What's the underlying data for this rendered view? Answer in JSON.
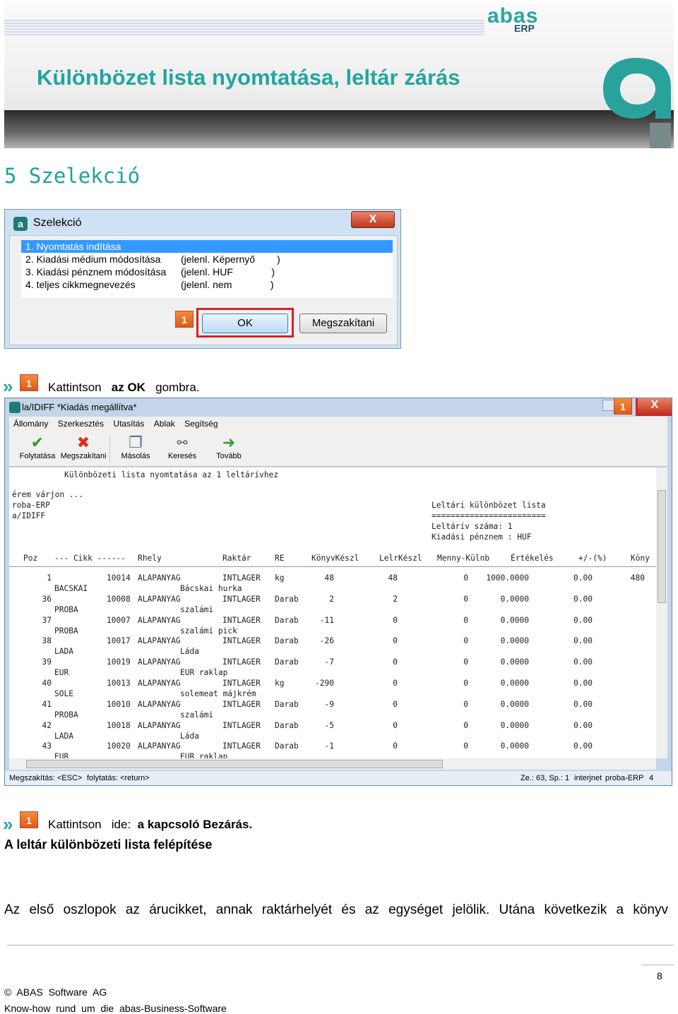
{
  "banner": {
    "title": "Különbözet lista nyomtatása, leltár zárás",
    "logo_text": "abas",
    "logo_sub": "ERP"
  },
  "section_title": "5 Szelekció",
  "dialog": {
    "title": "Szelekció",
    "close": "X",
    "items": [
      {
        "label": "1. Nyomtatás indítása",
        "value": ""
      },
      {
        "label": "2. Kiadási médium módosítása",
        "value": "(jelenl. Képernyő        )"
      },
      {
        "label": "3. Kiadási pénznem módosítása",
        "value": "(jelenl. HUF              )"
      },
      {
        "label": "4. teljes cikkmegnevezés",
        "value": "(jelenl. nem              )"
      }
    ],
    "badge": "1",
    "ok": "OK",
    "cancel": "Megszakítani"
  },
  "instruction1": {
    "marker": "»",
    "badge": "1",
    "pre": "Kattintson",
    "bold": "az OK",
    "post": "gombra."
  },
  "app": {
    "title": "la/IDIFF  *Kiadás megállítva*",
    "close": "X",
    "badge": "1",
    "menu": [
      "Állomány",
      "Szerkesztés",
      "Utasítás",
      "Ablak",
      "Segítség"
    ],
    "toolbar": [
      {
        "label": "Folytatása",
        "icon": "check-icon"
      },
      {
        "label": "Megszakítani",
        "icon": "cross-icon"
      },
      {
        "label": "Másolás",
        "icon": "copy-icon"
      },
      {
        "label": "Keresés",
        "icon": "binoculars-icon"
      },
      {
        "label": "Tovább",
        "icon": "forward-icon"
      }
    ],
    "content_header": "Különbözeti lista nyomtatása az 1 leltárívhez",
    "left_lines": [
      "érem várjon ...",
      "roba-ERP",
      "a/IDIFF"
    ],
    "right_lines": [
      "Leltári különbözet lista",
      "========================",
      "Leltárív száma: 1",
      "Kiadási pénznem : HUF"
    ],
    "columns": [
      "Poz",
      "--- Cikk ------",
      "Rhely",
      "Raktár",
      "RE",
      "KönyvKészl",
      "LelrKészl",
      "Menny-Külnb",
      "Értékelés",
      "+/-(%)",
      "Köny"
    ],
    "rows": [
      {
        "poz": "1",
        "cikk": "10014",
        "type": "ALAPANYAG",
        "store": "INTLAGER",
        "unit": "kg",
        "book": "48",
        "inv": "48",
        "diff": "0",
        "value": "1000.0000",
        "pct": "0.00",
        "extra": "480",
        "sub1": "BACSKAI",
        "sub2": "Bácskai hurka"
      },
      {
        "poz": "36",
        "cikk": "10008",
        "type": "ALAPANYAG",
        "store": "INTLAGER",
        "unit": "Darab",
        "book": "2",
        "inv": "2",
        "diff": "0",
        "value": "0.0000",
        "pct": "0.00",
        "extra": "",
        "sub1": "PROBA",
        "sub2": "szalámi"
      },
      {
        "poz": "37",
        "cikk": "10007",
        "type": "ALAPANYAG",
        "store": "INTLAGER",
        "unit": "Darab",
        "book": "-11",
        "inv": "0",
        "diff": "0",
        "value": "0.0000",
        "pct": "0.00",
        "extra": "",
        "sub1": "PROBA",
        "sub2": "szalámi pick"
      },
      {
        "poz": "38",
        "cikk": "10017",
        "type": "ALAPANYAG",
        "store": "INTLAGER",
        "unit": "Darab",
        "book": "-26",
        "inv": "0",
        "diff": "0",
        "value": "0.0000",
        "pct": "0.00",
        "extra": "",
        "sub1": "LADA",
        "sub2": "Láda"
      },
      {
        "poz": "39",
        "cikk": "10019",
        "type": "ALAPANYAG",
        "store": "INTLAGER",
        "unit": "Darab",
        "book": "-7",
        "inv": "0",
        "diff": "0",
        "value": "0.0000",
        "pct": "0.00",
        "extra": "",
        "sub1": "EUR",
        "sub2": "EUR raklap"
      },
      {
        "poz": "40",
        "cikk": "10013",
        "type": "ALAPANYAG",
        "store": "INTLAGER",
        "unit": "kg",
        "book": "-290",
        "inv": "0",
        "diff": "0",
        "value": "0.0000",
        "pct": "0.00",
        "extra": "",
        "sub1": "SOLE",
        "sub2": "solemeat májkrém"
      },
      {
        "poz": "41",
        "cikk": "10010",
        "type": "ALAPANYAG",
        "store": "INTLAGER",
        "unit": "Darab",
        "book": "-9",
        "inv": "0",
        "diff": "0",
        "value": "0.0000",
        "pct": "0.00",
        "extra": "",
        "sub1": "PROBA",
        "sub2": "szalámi"
      },
      {
        "poz": "42",
        "cikk": "10018",
        "type": "ALAPANYAG",
        "store": "INTLAGER",
        "unit": "Darab",
        "book": "-5",
        "inv": "0",
        "diff": "0",
        "value": "0.0000",
        "pct": "0.00",
        "extra": "",
        "sub1": "LADA",
        "sub2": "Láda"
      },
      {
        "poz": "43",
        "cikk": "10020",
        "type": "ALAPANYAG",
        "store": "INTLAGER",
        "unit": "Darab",
        "book": "-1",
        "inv": "0",
        "diff": "0",
        "value": "0.0000",
        "pct": "0.00",
        "extra": "",
        "sub1": "EUR",
        "sub2": "EUR raklap"
      }
    ],
    "status": {
      "left1": "Megszakítás: <ESC>",
      "left2": "folytatás: <return>",
      "pos": "Ze.: 63,  Sp.: 1",
      "mode": "interjnet",
      "client": "proba-ERP",
      "num": "4"
    }
  },
  "instruction2": {
    "marker": "»",
    "badge": "1",
    "pre": "Kattintson",
    "mid": "ide:",
    "bold": "a kapcsoló Bezárás."
  },
  "heading": "A leltár különbözeti lista felépítése",
  "paragraph": "Az első oszlopok az árucikket, annak raktárhelyét és az egységet jelölik. Utána következik a könyv",
  "page_number": "8",
  "footer": {
    "line1": "© ABAS Software AG",
    "line2": "Know-how rund um die abas-Business-Software"
  }
}
